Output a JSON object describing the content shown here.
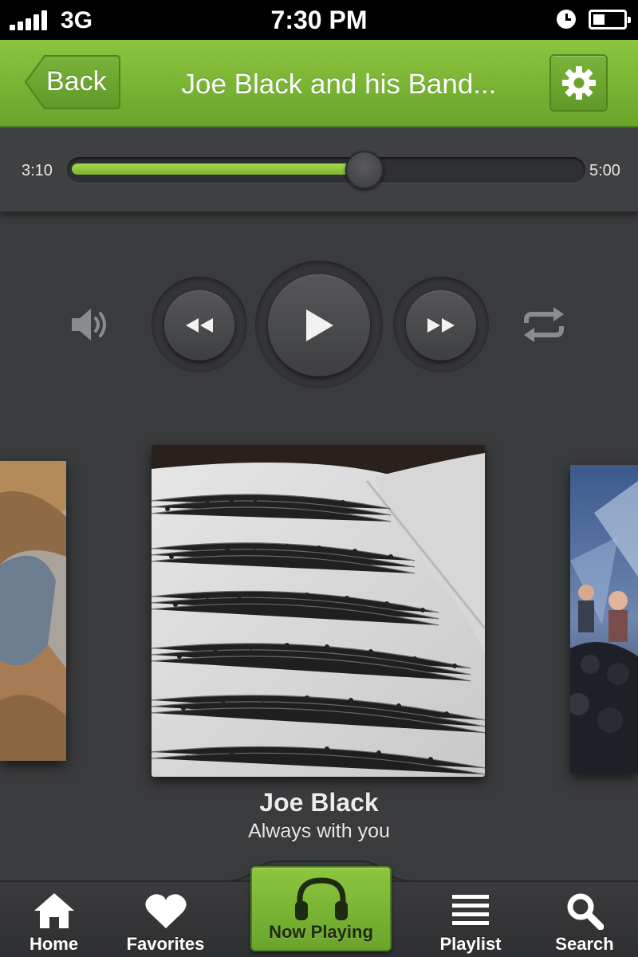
{
  "status_bar": {
    "carrier": "3G",
    "time": "7:30 PM",
    "icons": [
      "signal-icon",
      "alarm-icon",
      "battery-icon"
    ]
  },
  "nav": {
    "back_label": "Back",
    "title": "Joe Black and his Band...",
    "settings_icon": "gear-icon"
  },
  "player": {
    "elapsed": "3:10",
    "total": "5:00",
    "progress": 0.575,
    "controls": [
      "volume-icon",
      "rewind-icon",
      "play-icon",
      "fast-forward-icon",
      "repeat-icon"
    ]
  },
  "now_playing": {
    "artist": "Joe Black",
    "song": "Always with you"
  },
  "tabs": [
    {
      "label": "Home",
      "icon": "home-icon"
    },
    {
      "label": "Favorites",
      "icon": "heart-icon"
    },
    {
      "label": "Now Playing",
      "icon": "headphones-icon",
      "active": true
    },
    {
      "label": "Playlist",
      "icon": "list-icon"
    },
    {
      "label": "Search",
      "icon": "search-icon"
    }
  ],
  "colors": {
    "accent": "#7db632",
    "background": "#3a3b3d",
    "nav_green": "#8cc63e"
  }
}
